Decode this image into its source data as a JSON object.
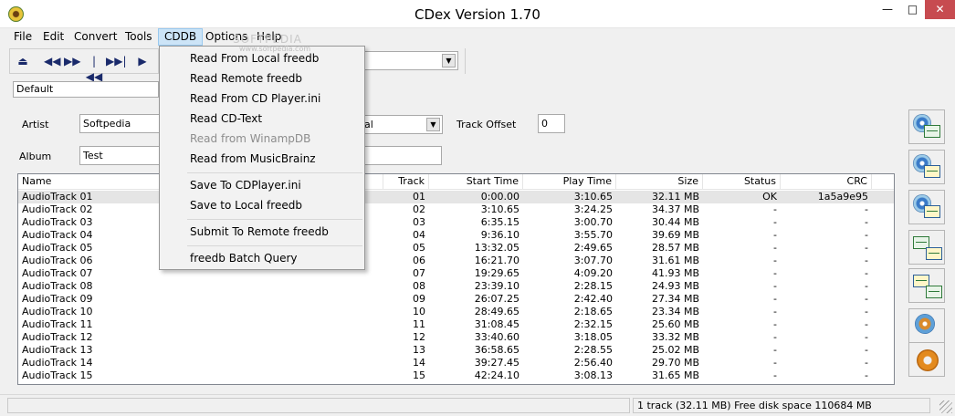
{
  "window": {
    "title": "CDex Version 1.70"
  },
  "menubar": {
    "items": [
      {
        "label": "File"
      },
      {
        "label": "Edit"
      },
      {
        "label": "Convert"
      },
      {
        "label": "Tools"
      },
      {
        "label": "CDDB",
        "active": true
      },
      {
        "label": "Options"
      },
      {
        "label": "Help"
      }
    ]
  },
  "cddb_menu": {
    "items": [
      "Read From Local freedb",
      "Read Remote freedb",
      "Read From CD Player.ini",
      "Read CD-Text",
      "Read from WinampDB",
      "Read from MusicBrainz",
      "Save To CDPlayer.ini",
      "Save to Local freedb",
      "Submit To Remote freedb",
      "freedb Batch Query"
    ],
    "disabled": [
      "Read from WinampDB"
    ]
  },
  "watermark": {
    "text": "SOFTPEDIA",
    "url": "www.softpedia.com"
  },
  "toolbar": {
    "icons": [
      "eject-icon",
      "rewind-icon",
      "fast-forward-icon",
      "previous-track-icon",
      "next-track-icon",
      "play-icon"
    ]
  },
  "profile": {
    "value": "Default"
  },
  "info": {
    "artist_label": "Artist",
    "artist_value": "Softpedia",
    "album_label": "Album",
    "album_value": "Test",
    "genre_value": "al",
    "track_offset_label": "Track Offset",
    "track_offset_value": "0"
  },
  "table": {
    "columns": {
      "name": "Name",
      "track": "Track",
      "start": "Start Time",
      "play": "Play Time",
      "size": "Size",
      "status": "Status",
      "crc": "CRC"
    },
    "rows": [
      {
        "name": "AudioTrack 01",
        "track": "01",
        "start": "0:00.00",
        "play": "3:10.65",
        "size": "32.11 MB",
        "status": "OK",
        "crc": "1a5a9e95"
      },
      {
        "name": "AudioTrack 02",
        "track": "02",
        "start": "3:10.65",
        "play": "3:24.25",
        "size": "34.37 MB",
        "status": "-",
        "crc": "-"
      },
      {
        "name": "AudioTrack 03",
        "track": "03",
        "start": "6:35.15",
        "play": "3:00.70",
        "size": "30.44 MB",
        "status": "-",
        "crc": "-"
      },
      {
        "name": "AudioTrack 04",
        "track": "04",
        "start": "9:36.10",
        "play": "3:55.70",
        "size": "39.69 MB",
        "status": "-",
        "crc": "-"
      },
      {
        "name": "AudioTrack 05",
        "track": "05",
        "start": "13:32.05",
        "play": "2:49.65",
        "size": "28.57 MB",
        "status": "-",
        "crc": "-"
      },
      {
        "name": "AudioTrack 06",
        "track": "06",
        "start": "16:21.70",
        "play": "3:07.70",
        "size": "31.61 MB",
        "status": "-",
        "crc": "-"
      },
      {
        "name": "AudioTrack 07",
        "track": "07",
        "start": "19:29.65",
        "play": "4:09.20",
        "size": "41.93 MB",
        "status": "-",
        "crc": "-"
      },
      {
        "name": "AudioTrack 08",
        "track": "08",
        "start": "23:39.10",
        "play": "2:28.15",
        "size": "24.93 MB",
        "status": "-",
        "crc": "-"
      },
      {
        "name": "AudioTrack 09",
        "track": "09",
        "start": "26:07.25",
        "play": "2:42.40",
        "size": "27.34 MB",
        "status": "-",
        "crc": "-"
      },
      {
        "name": "AudioTrack 10",
        "track": "10",
        "start": "28:49.65",
        "play": "2:18.65",
        "size": "23.34 MB",
        "status": "-",
        "crc": "-"
      },
      {
        "name": "AudioTrack 11",
        "track": "11",
        "start": "31:08.45",
        "play": "2:32.15",
        "size": "25.60 MB",
        "status": "-",
        "crc": "-"
      },
      {
        "name": "AudioTrack 12",
        "track": "12",
        "start": "33:40.60",
        "play": "3:18.05",
        "size": "33.32 MB",
        "status": "-",
        "crc": "-"
      },
      {
        "name": "AudioTrack 13",
        "track": "13",
        "start": "36:58.65",
        "play": "2:28.55",
        "size": "25.02 MB",
        "status": "-",
        "crc": "-"
      },
      {
        "name": "AudioTrack 14",
        "track": "14",
        "start": "39:27.45",
        "play": "2:56.40",
        "size": "29.70 MB",
        "status": "-",
        "crc": "-"
      },
      {
        "name": "AudioTrack 15",
        "track": "15",
        "start": "42:24.10",
        "play": "3:08.13",
        "size": "31.65 MB",
        "status": "-",
        "crc": "-"
      }
    ]
  },
  "side_buttons": [
    "cd-to-wav-icon",
    "cd-to-mp3-icon",
    "cd-to-encoded-icon",
    "wav-to-mp3-icon",
    "mp3-to-wav-icon",
    "record-icon",
    "settings-gear-icon"
  ],
  "statusbar": {
    "text": "1 track (32.11 MB) Free disk space 110684 MB"
  },
  "colors": {
    "accent": "#cce4f7",
    "close": "#c74b50",
    "selection": "#e5e5e5"
  }
}
